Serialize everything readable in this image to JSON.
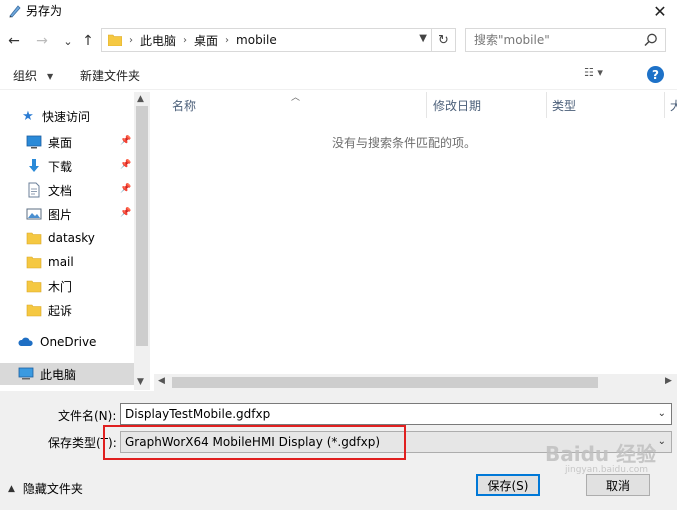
{
  "window": {
    "title": "另存为",
    "close": "✕"
  },
  "nav": {
    "back": "←",
    "forward": "→",
    "recent": "⌄",
    "up": "↑",
    "breadcrumb": [
      "此电脑",
      "桌面",
      "mobile"
    ],
    "sep": "›",
    "refresh": "↻",
    "search_placeholder": "搜索\"mobile\""
  },
  "toolbar": {
    "organize": "组织",
    "new_folder": "新建文件夹",
    "view": "☷ ▾",
    "help": "?"
  },
  "sidebar": {
    "quick_access": "快速访问",
    "items": [
      {
        "label": "桌面",
        "icon": "desktop-icon",
        "pinned": true
      },
      {
        "label": "下载",
        "icon": "download-icon",
        "pinned": true
      },
      {
        "label": "文档",
        "icon": "document-icon",
        "pinned": true
      },
      {
        "label": "图片",
        "icon": "picture-icon",
        "pinned": true
      },
      {
        "label": "datasky",
        "icon": "folder-icon",
        "pinned": false
      },
      {
        "label": "mail",
        "icon": "folder-icon",
        "pinned": false
      },
      {
        "label": "木门",
        "icon": "folder-icon",
        "pinned": false
      },
      {
        "label": "起诉",
        "icon": "folder-icon",
        "pinned": false
      }
    ],
    "onedrive": "OneDrive",
    "this_pc": "此电脑"
  },
  "files": {
    "columns": [
      "名称",
      "修改日期",
      "类型",
      "大"
    ],
    "empty_message": "没有与搜索条件匹配的项。"
  },
  "save": {
    "filename_label": "文件名(N):",
    "filename_value": "DisplayTestMobile.gdfxp",
    "filetype_label": "保存类型(T):",
    "filetype_value": "GraphWorX64 MobileHMI Display (*.gdfxp)",
    "hide_folders": "隐藏文件夹",
    "save_button": "保存(S)",
    "cancel_button": "取消"
  },
  "watermark": {
    "main": "Baidu 经验",
    "sub": "jingyan.baidu.com"
  },
  "colors": {
    "accent": "#0078d7",
    "highlight": "#e02020",
    "folder": "#f5c842",
    "help": "#1e72c8"
  }
}
